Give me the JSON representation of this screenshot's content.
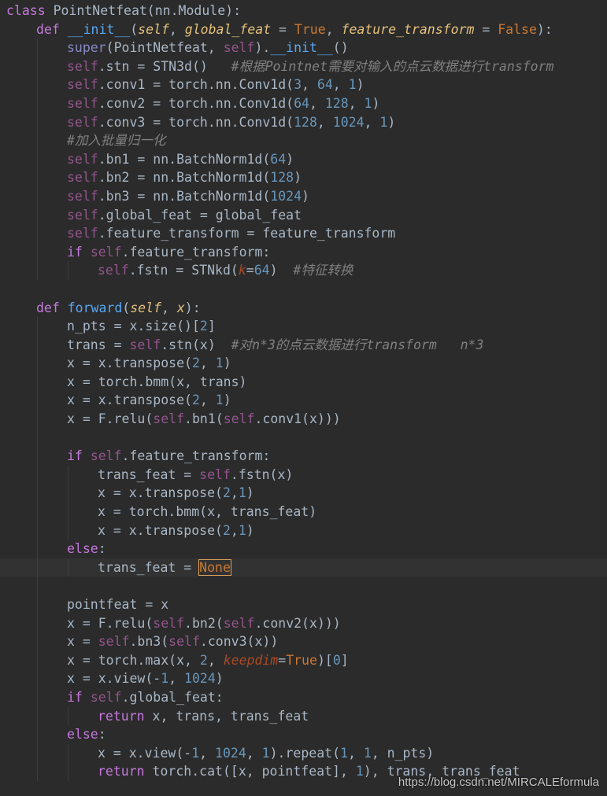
{
  "colors": {
    "background": "#2b2b2b",
    "keyword": "#cc7832",
    "self": "#94558d",
    "function": "#56a8f5",
    "number": "#6897bb",
    "comment": "#808080",
    "text": "#a9b7c6"
  },
  "code_lines": [
    {
      "indent": 0,
      "tokens": [
        [
          "keyword2",
          "class"
        ],
        [
          "cls",
          " PointNetfeat(nn.Module):"
        ]
      ]
    },
    {
      "indent": 1,
      "tokens": [
        [
          "keyword2",
          "def"
        ],
        [
          "cls",
          " "
        ],
        [
          "fn",
          "__init__"
        ],
        [
          "cls",
          "("
        ],
        [
          "param",
          "self"
        ],
        [
          "cls",
          ", "
        ],
        [
          "param",
          "global_feat"
        ],
        [
          "cls",
          " = "
        ],
        [
          "kw",
          "True"
        ],
        [
          "cls",
          ", "
        ],
        [
          "param",
          "feature_transform"
        ],
        [
          "cls",
          " = "
        ],
        [
          "kw",
          "False"
        ],
        [
          "cls",
          "):"
        ]
      ]
    },
    {
      "indent": 2,
      "tokens": [
        [
          "builtin",
          "super"
        ],
        [
          "cls",
          "(PointNetfeat, "
        ],
        [
          "self",
          "self"
        ],
        [
          "cls",
          ")."
        ],
        [
          "fn",
          "__init__"
        ],
        [
          "cls",
          "()"
        ]
      ]
    },
    {
      "indent": 2,
      "tokens": [
        [
          "self",
          "self"
        ],
        [
          "cls",
          ".stn = STN3d()   "
        ],
        [
          "cmt",
          "#根据Pointnet需要对输入的点云数据进行transform"
        ]
      ]
    },
    {
      "indent": 2,
      "tokens": [
        [
          "self",
          "self"
        ],
        [
          "cls",
          ".conv1 = torch.nn.Conv1d("
        ],
        [
          "num",
          "3"
        ],
        [
          "cls",
          ", "
        ],
        [
          "num",
          "64"
        ],
        [
          "cls",
          ", "
        ],
        [
          "num",
          "1"
        ],
        [
          "cls",
          ")"
        ]
      ]
    },
    {
      "indent": 2,
      "tokens": [
        [
          "self",
          "self"
        ],
        [
          "cls",
          ".conv2 = torch.nn.Conv1d("
        ],
        [
          "num",
          "64"
        ],
        [
          "cls",
          ", "
        ],
        [
          "num",
          "128"
        ],
        [
          "cls",
          ", "
        ],
        [
          "num",
          "1"
        ],
        [
          "cls",
          ")"
        ]
      ]
    },
    {
      "indent": 2,
      "tokens": [
        [
          "self",
          "self"
        ],
        [
          "cls",
          ".conv3 = torch.nn.Conv1d("
        ],
        [
          "num",
          "128"
        ],
        [
          "cls",
          ", "
        ],
        [
          "num",
          "1024"
        ],
        [
          "cls",
          ", "
        ],
        [
          "num",
          "1"
        ],
        [
          "cls",
          ")"
        ]
      ]
    },
    {
      "indent": 2,
      "tokens": [
        [
          "cmt",
          "#加入批量归一化"
        ]
      ]
    },
    {
      "indent": 2,
      "tokens": [
        [
          "self",
          "self"
        ],
        [
          "cls",
          ".bn1 = nn.BatchNorm1d("
        ],
        [
          "num",
          "64"
        ],
        [
          "cls",
          ")"
        ]
      ]
    },
    {
      "indent": 2,
      "tokens": [
        [
          "self",
          "self"
        ],
        [
          "cls",
          ".bn2 = nn.BatchNorm1d("
        ],
        [
          "num",
          "128"
        ],
        [
          "cls",
          ")"
        ]
      ]
    },
    {
      "indent": 2,
      "tokens": [
        [
          "self",
          "self"
        ],
        [
          "cls",
          ".bn3 = nn.BatchNorm1d("
        ],
        [
          "num",
          "1024"
        ],
        [
          "cls",
          ")"
        ]
      ]
    },
    {
      "indent": 2,
      "tokens": [
        [
          "self",
          "self"
        ],
        [
          "cls",
          ".global_feat = global_feat"
        ]
      ]
    },
    {
      "indent": 2,
      "tokens": [
        [
          "self",
          "self"
        ],
        [
          "cls",
          ".feature_transform = feature_transform"
        ]
      ]
    },
    {
      "indent": 2,
      "tokens": [
        [
          "keyword2",
          "if"
        ],
        [
          "cls",
          " "
        ],
        [
          "self",
          "self"
        ],
        [
          "cls",
          ".feature_transform:"
        ]
      ]
    },
    {
      "indent": 3,
      "tokens": [
        [
          "self",
          "self"
        ],
        [
          "cls",
          ".fstn = STNkd("
        ],
        [
          "kwarg",
          "k"
        ],
        [
          "cls",
          "="
        ],
        [
          "num",
          "64"
        ],
        [
          "cls",
          ")  "
        ],
        [
          "cmt",
          "#特征转换"
        ]
      ]
    },
    {
      "indent": 1,
      "tokens": []
    },
    {
      "indent": 1,
      "tokens": [
        [
          "keyword2",
          "def"
        ],
        [
          "cls",
          " "
        ],
        [
          "fn",
          "forward"
        ],
        [
          "cls",
          "("
        ],
        [
          "param",
          "self"
        ],
        [
          "cls",
          ", "
        ],
        [
          "param",
          "x"
        ],
        [
          "cls",
          "):"
        ]
      ]
    },
    {
      "indent": 2,
      "tokens": [
        [
          "cls",
          "n_pts = x.size()["
        ],
        [
          "num",
          "2"
        ],
        [
          "cls",
          "]"
        ]
      ]
    },
    {
      "indent": 2,
      "tokens": [
        [
          "cls",
          "trans = "
        ],
        [
          "self",
          "self"
        ],
        [
          "cls",
          ".stn(x)  "
        ],
        [
          "cmt",
          "#对n*3的点云数据进行transform   n*3"
        ]
      ]
    },
    {
      "indent": 2,
      "tokens": [
        [
          "cls",
          "x = x.transpose("
        ],
        [
          "num",
          "2"
        ],
        [
          "cls",
          ", "
        ],
        [
          "num",
          "1"
        ],
        [
          "cls",
          ")"
        ]
      ]
    },
    {
      "indent": 2,
      "tokens": [
        [
          "cls",
          "x = torch.bmm(x, trans)"
        ]
      ]
    },
    {
      "indent": 2,
      "tokens": [
        [
          "cls",
          "x = x.transpose("
        ],
        [
          "num",
          "2"
        ],
        [
          "cls",
          ", "
        ],
        [
          "num",
          "1"
        ],
        [
          "cls",
          ")"
        ]
      ]
    },
    {
      "indent": 2,
      "tokens": [
        [
          "cls",
          "x = F.relu("
        ],
        [
          "self",
          "self"
        ],
        [
          "cls",
          ".bn1("
        ],
        [
          "self",
          "self"
        ],
        [
          "cls",
          ".conv1(x)))"
        ]
      ]
    },
    {
      "indent": 2,
      "tokens": []
    },
    {
      "indent": 2,
      "tokens": [
        [
          "keyword2",
          "if"
        ],
        [
          "cls",
          " "
        ],
        [
          "self",
          "self"
        ],
        [
          "cls",
          ".feature_transform:"
        ]
      ]
    },
    {
      "indent": 3,
      "tokens": [
        [
          "cls",
          "trans_feat = "
        ],
        [
          "self",
          "self"
        ],
        [
          "cls",
          ".fstn(x)"
        ]
      ]
    },
    {
      "indent": 3,
      "tokens": [
        [
          "cls",
          "x = x.transpose("
        ],
        [
          "num",
          "2"
        ],
        [
          "cls",
          ","
        ],
        [
          "num",
          "1"
        ],
        [
          "cls",
          ")"
        ]
      ]
    },
    {
      "indent": 3,
      "tokens": [
        [
          "cls",
          "x = torch.bmm(x, trans_feat)"
        ]
      ]
    },
    {
      "indent": 3,
      "tokens": [
        [
          "cls",
          "x = x.transpose("
        ],
        [
          "num",
          "2"
        ],
        [
          "cls",
          ","
        ],
        [
          "num",
          "1"
        ],
        [
          "cls",
          ")"
        ]
      ]
    },
    {
      "indent": 2,
      "tokens": [
        [
          "keyword2",
          "else"
        ],
        [
          "cls",
          ":"
        ]
      ]
    },
    {
      "indent": 3,
      "current": true,
      "tokens": [
        [
          "cls",
          "trans_feat = "
        ],
        [
          "kwbox",
          "None"
        ]
      ]
    },
    {
      "indent": 2,
      "tokens": []
    },
    {
      "indent": 2,
      "tokens": [
        [
          "cls",
          "pointfeat = x"
        ]
      ]
    },
    {
      "indent": 2,
      "tokens": [
        [
          "cls",
          "x = F.relu("
        ],
        [
          "self",
          "self"
        ],
        [
          "cls",
          ".bn2("
        ],
        [
          "self",
          "self"
        ],
        [
          "cls",
          ".conv2(x)))"
        ]
      ]
    },
    {
      "indent": 2,
      "tokens": [
        [
          "cls",
          "x = "
        ],
        [
          "self",
          "self"
        ],
        [
          "cls",
          ".bn3("
        ],
        [
          "self",
          "self"
        ],
        [
          "cls",
          ".conv3(x))"
        ]
      ]
    },
    {
      "indent": 2,
      "tokens": [
        [
          "cls",
          "x = torch.max(x, "
        ],
        [
          "num",
          "2"
        ],
        [
          "cls",
          ", "
        ],
        [
          "kwarg",
          "keepdim"
        ],
        [
          "cls",
          "="
        ],
        [
          "kw",
          "True"
        ],
        [
          "cls",
          ")["
        ],
        [
          "num",
          "0"
        ],
        [
          "cls",
          "]"
        ]
      ]
    },
    {
      "indent": 2,
      "tokens": [
        [
          "cls",
          "x = x.view(-"
        ],
        [
          "num",
          "1"
        ],
        [
          "cls",
          ", "
        ],
        [
          "num",
          "1024"
        ],
        [
          "cls",
          ")"
        ]
      ]
    },
    {
      "indent": 2,
      "tokens": [
        [
          "keyword2",
          "if"
        ],
        [
          "cls",
          " "
        ],
        [
          "self",
          "self"
        ],
        [
          "cls",
          ".global_feat:"
        ]
      ]
    },
    {
      "indent": 3,
      "tokens": [
        [
          "keyword2",
          "return"
        ],
        [
          "cls",
          " x, trans, trans_feat"
        ]
      ]
    },
    {
      "indent": 2,
      "tokens": [
        [
          "keyword2",
          "else"
        ],
        [
          "cls",
          ":"
        ]
      ]
    },
    {
      "indent": 3,
      "tokens": [
        [
          "cls",
          "x = x.view(-"
        ],
        [
          "num",
          "1"
        ],
        [
          "cls",
          ", "
        ],
        [
          "num",
          "1024"
        ],
        [
          "cls",
          ", "
        ],
        [
          "num",
          "1"
        ],
        [
          "cls",
          ").repeat("
        ],
        [
          "num",
          "1"
        ],
        [
          "cls",
          ", "
        ],
        [
          "num",
          "1"
        ],
        [
          "cls",
          ", n_pts)"
        ]
      ]
    },
    {
      "indent": 3,
      "tokens": [
        [
          "keyword2",
          "return"
        ],
        [
          "cls",
          " torch.cat([x, pointfeat], "
        ],
        [
          "num",
          "1"
        ],
        [
          "cls",
          "), trans, trans_feat"
        ]
      ]
    }
  ],
  "watermark": "https://blog.csdn.net/MIRCALEformula"
}
